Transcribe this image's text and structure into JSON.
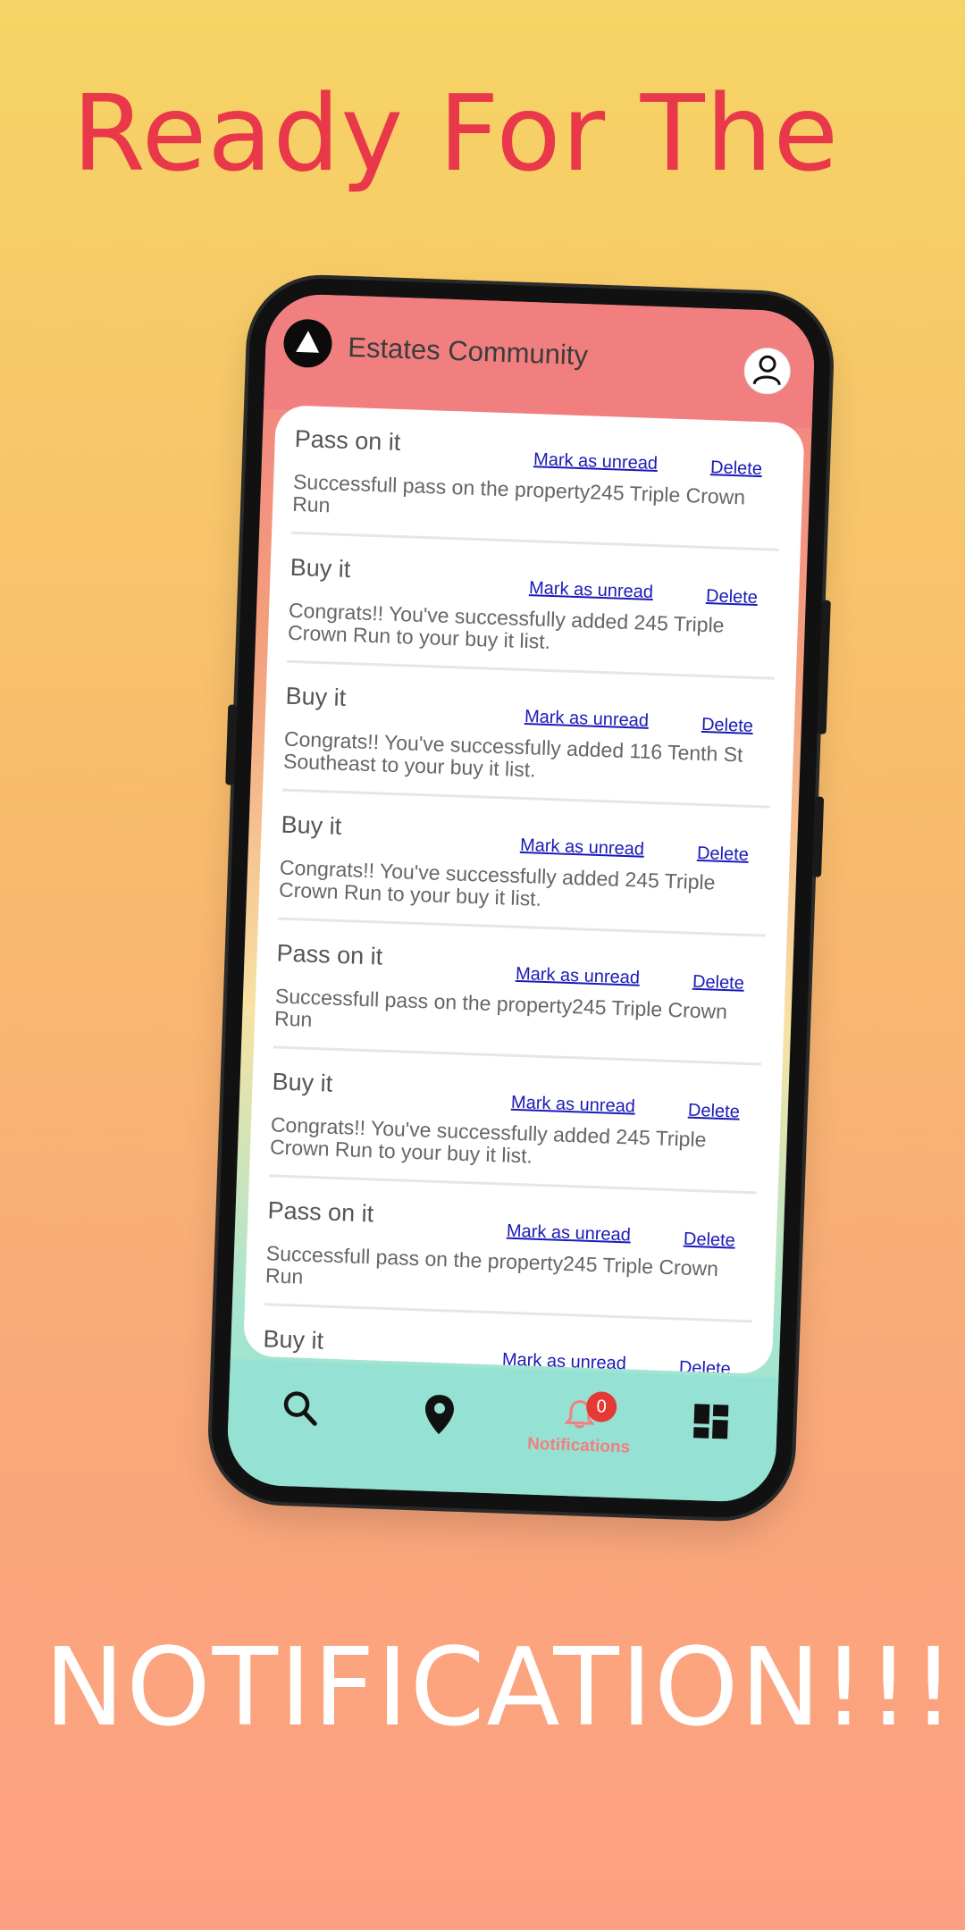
{
  "promo": {
    "headline_top": "Ready For The",
    "headline_bottom": "NOTIFICATION!!!"
  },
  "app": {
    "title": "Estates Community"
  },
  "notifications": [
    {
      "title": "Pass on it",
      "mark_label": "Mark as unread",
      "delete_label": "Delete",
      "body": "Successfull pass on the property245 Triple Crown Run"
    },
    {
      "title": "Buy it",
      "mark_label": "Mark as unread",
      "delete_label": "Delete",
      "body": "Congrats!! You've successfully added 245 Triple Crown Run to your buy it list."
    },
    {
      "title": "Buy it",
      "mark_label": "Mark as unread",
      "delete_label": "Delete",
      "body": "Congrats!! You've successfully added 116 Tenth St Southeast to your buy it list."
    },
    {
      "title": "Buy it",
      "mark_label": "Mark as unread",
      "delete_label": "Delete",
      "body": "Congrats!! You've successfully added 245 Triple Crown Run to your buy it list."
    },
    {
      "title": "Pass on it",
      "mark_label": "Mark as unread",
      "delete_label": "Delete",
      "body": "Successfull pass on the property245 Triple Crown Run"
    },
    {
      "title": "Buy it",
      "mark_label": "Mark as unread",
      "delete_label": "Delete",
      "body": "Congrats!! You've successfully added 245 Triple Crown Run to your buy it list."
    },
    {
      "title": "Pass on it",
      "mark_label": "Mark as unread",
      "delete_label": "Delete",
      "body": "Successfull pass on the property245 Triple Crown Run"
    },
    {
      "title": "Buy it",
      "mark_label": "Mark as unread",
      "delete_label": "Delete",
      "body": ""
    }
  ],
  "bottom_nav": {
    "items": [
      {
        "icon": "search-icon"
      },
      {
        "icon": "location-pin-icon"
      },
      {
        "icon": "bell-icon",
        "label": "Notifications",
        "badge": "0",
        "active": true
      },
      {
        "icon": "dashboard-icon"
      }
    ]
  },
  "colors": {
    "headline_top": "#e8384a",
    "header": "#f27f7f",
    "nav": "#95e1d3",
    "link": "#1a1ab8",
    "active": "#f27f7f",
    "badge": "#e53935"
  }
}
